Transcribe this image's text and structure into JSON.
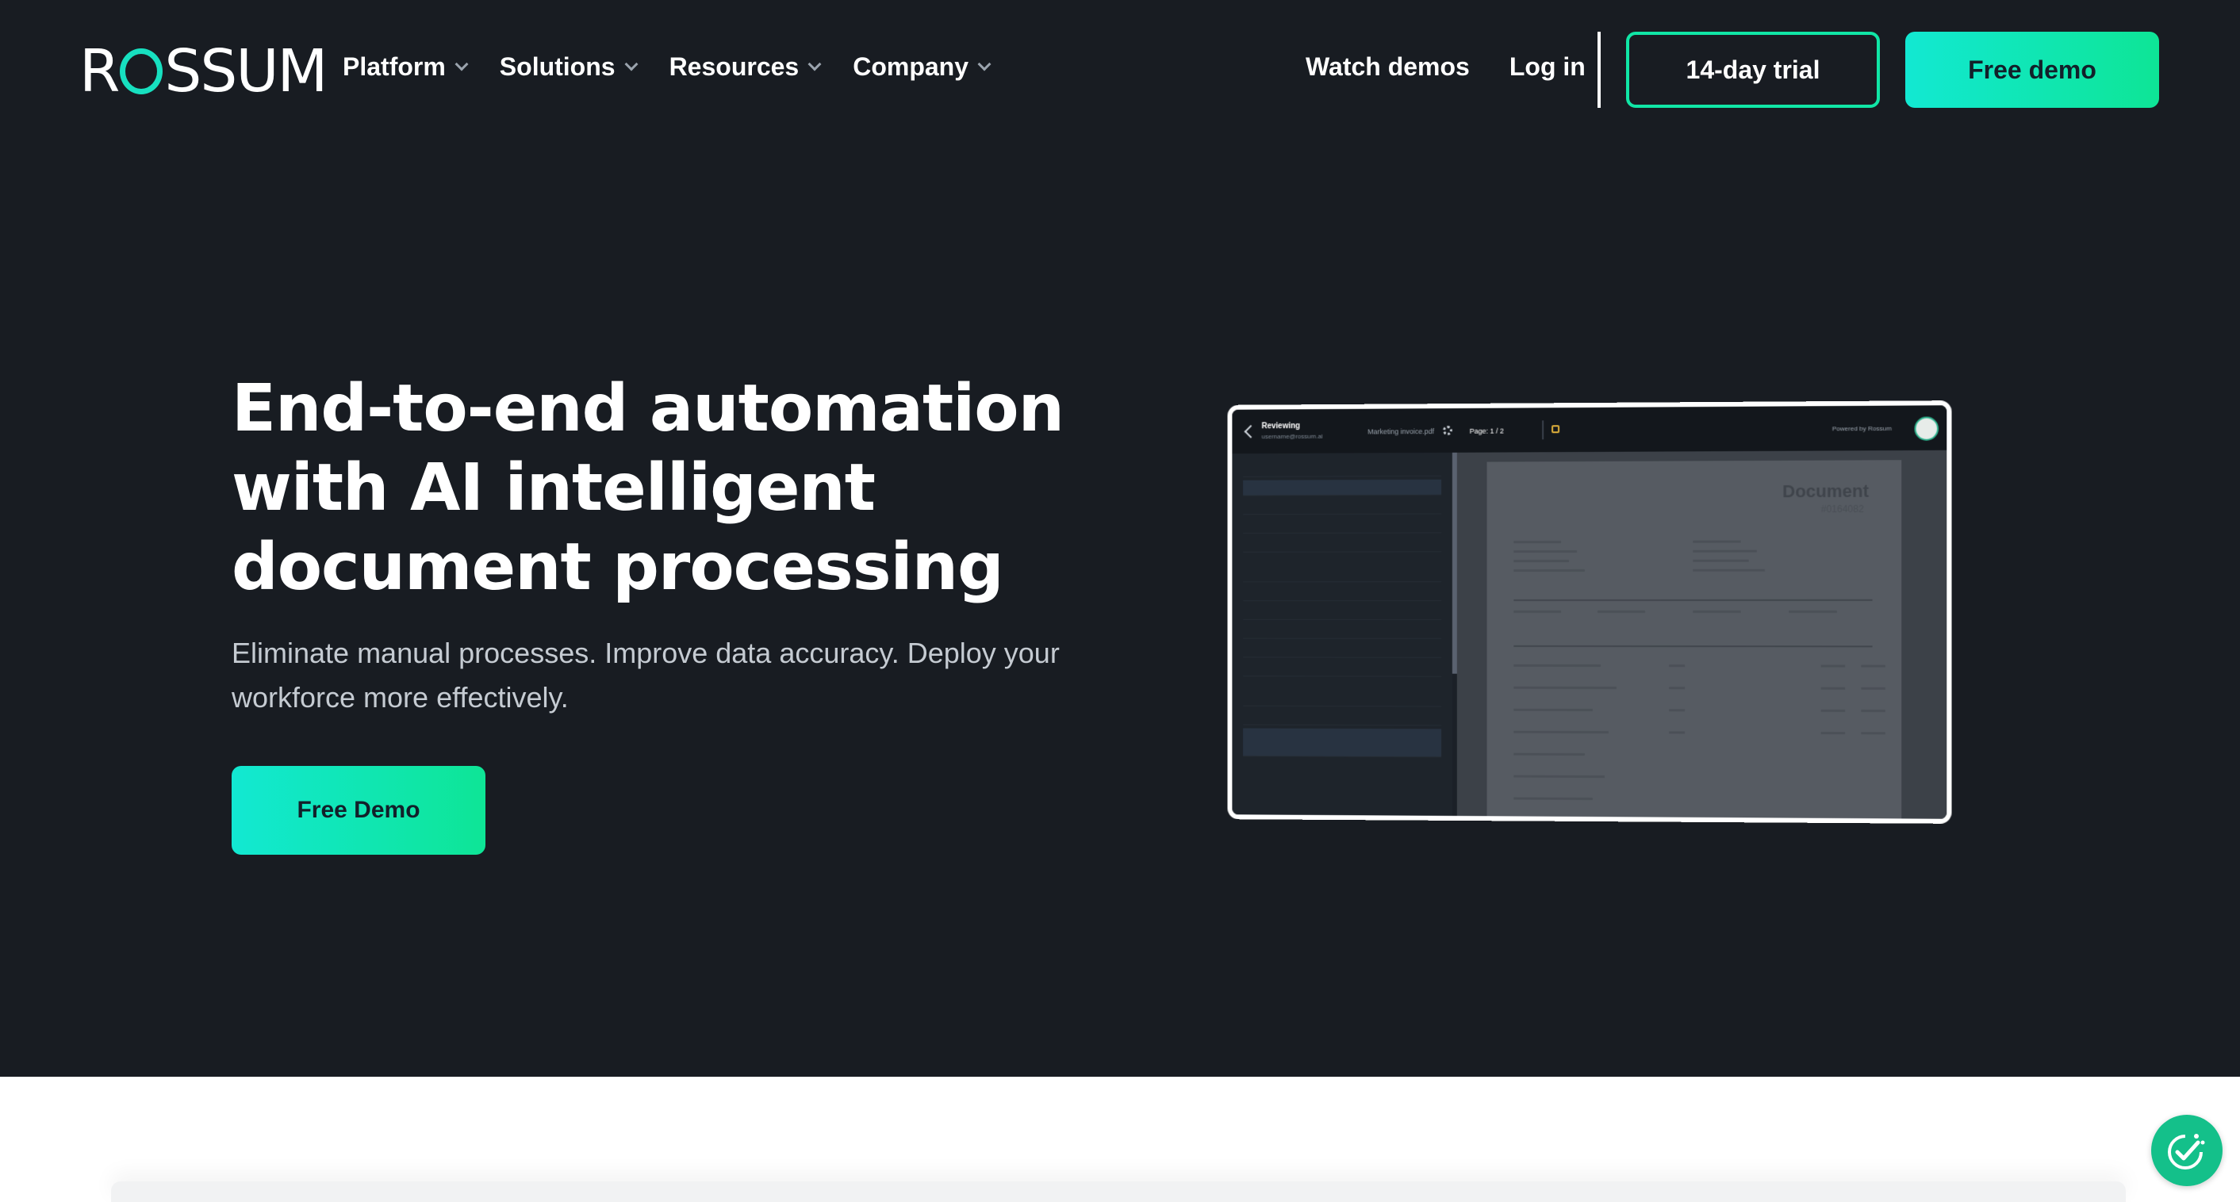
{
  "brand": {
    "name": "ROSSUM",
    "accent": "#17e0c0",
    "gradient_from": "#12e8d2",
    "gradient_to": "#0ee596",
    "background": "#181c22"
  },
  "nav": {
    "menu": [
      {
        "label": "Platform"
      },
      {
        "label": "Solutions"
      },
      {
        "label": "Resources"
      },
      {
        "label": "Company"
      }
    ],
    "watch_demos": "Watch demos",
    "log_in": "Log in",
    "trial_button": "14-day trial",
    "demo_button": "Free demo"
  },
  "hero": {
    "title": "End-to-end automation with AI intelligent document processing",
    "subtitle": "Eliminate manual processes. Improve data accuracy. Deploy your workforce more effectively.",
    "cta": "Free Demo"
  },
  "preview": {
    "status": "Reviewing",
    "user": "username@rossum.ai",
    "file": "Marketing invoice.pdf",
    "page": "Page: 1 / 2",
    "powered_by": "Powered by Rossum",
    "doc_title": "Document",
    "doc_number": "#0164082"
  },
  "icons": {
    "menu_chevron": "chevron-down-icon",
    "back": "arrow-left-icon",
    "settings": "gear-icon",
    "cookie": "cookie-consent-icon"
  }
}
